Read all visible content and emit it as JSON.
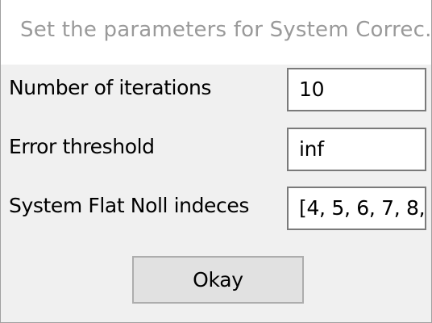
{
  "dialog": {
    "title": "Set the parameters for System Correc..."
  },
  "fields": [
    {
      "label": "Number of iterations",
      "value": "10"
    },
    {
      "label": "Error threshold",
      "value": "inf"
    },
    {
      "label": "System Flat Noll indeces",
      "value": "[4, 5, 6, 7, 8,"
    }
  ],
  "buttons": {
    "okay_label": "Okay"
  }
}
